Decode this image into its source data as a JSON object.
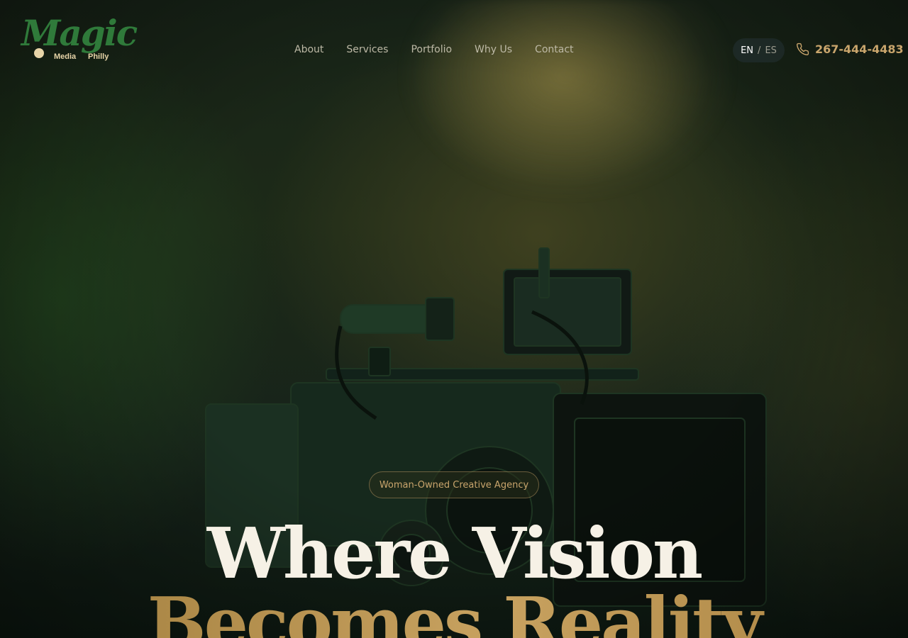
{
  "logo": {
    "script": "Magic",
    "sub1": "Media",
    "sub2": "Philly"
  },
  "nav": {
    "items": [
      "About",
      "Services",
      "Portfolio",
      "Why Us",
      "Contact"
    ]
  },
  "language": {
    "active": "EN",
    "separator": "/",
    "inactive": "ES"
  },
  "phone": {
    "number": "267-444-4483",
    "icon": "phone-icon"
  },
  "hero": {
    "badge": "Woman-Owned Creative Agency",
    "title_line1": "Where Vision",
    "title_line2": "Becomes Reality",
    "background_icon": "cinema-camera"
  },
  "colors": {
    "accent_gold": "#c9a56c",
    "brand_green": "#2f7a3a",
    "title_white": "#f6f1e6"
  }
}
